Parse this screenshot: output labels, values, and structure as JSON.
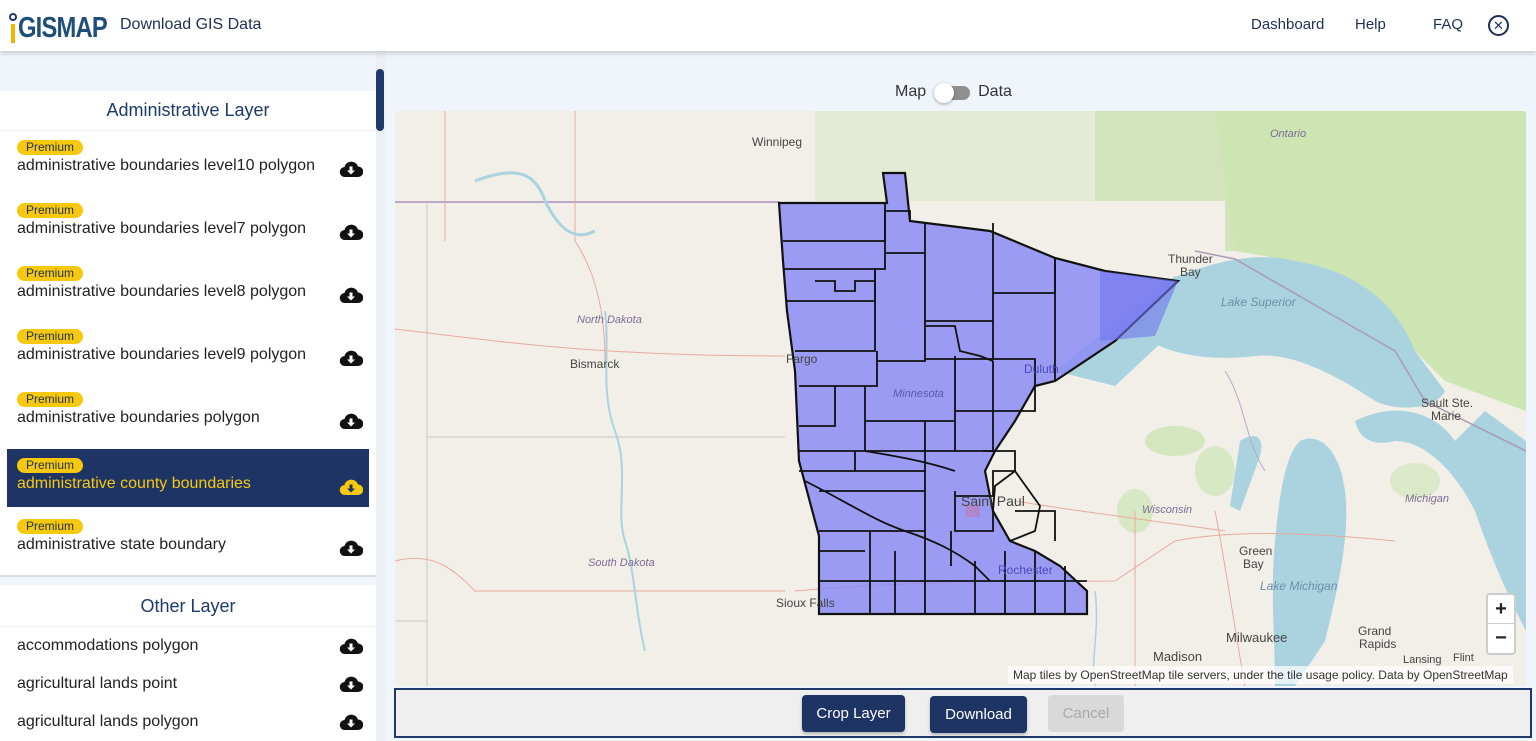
{
  "header": {
    "logo_text": "GISMAP",
    "app_title": "Download GIS Data",
    "nav": [
      "Dashboard",
      "Help",
      "FAQ"
    ],
    "close_icon": "close-circle-icon"
  },
  "sidebar": {
    "admin_section_title": "Administrative Layer",
    "admin_items": [
      {
        "badge": "Premium",
        "label": "administrative boundaries level10 polygon",
        "icon": "cloud-download-icon",
        "selected": false
      },
      {
        "badge": "Premium",
        "label": "administrative boundaries level7 polygon",
        "icon": "cloud-download-icon",
        "selected": false
      },
      {
        "badge": "Premium",
        "label": "administrative boundaries level8 polygon",
        "icon": "cloud-download-icon",
        "selected": false
      },
      {
        "badge": "Premium",
        "label": "administrative boundaries level9 polygon",
        "icon": "cloud-download-icon",
        "selected": false
      },
      {
        "badge": "Premium",
        "label": "administrative boundaries polygon",
        "icon": "cloud-download-icon",
        "selected": false
      },
      {
        "badge": "Premium",
        "label": "administrative county boundaries",
        "icon": "cloud-download-icon",
        "selected": true
      },
      {
        "badge": "Premium",
        "label": "administrative state boundary",
        "icon": "cloud-download-icon",
        "selected": false
      }
    ],
    "other_section_title": "Other Layer",
    "other_items": [
      {
        "label": "accommodations polygon",
        "icon": "cloud-download-icon"
      },
      {
        "label": "agricultural lands point",
        "icon": "cloud-download-icon"
      },
      {
        "label": "agricultural lands polygon",
        "icon": "cloud-download-icon"
      }
    ]
  },
  "view_toggle": {
    "left_label": "Map",
    "right_label": "Data",
    "active": "Map"
  },
  "map": {
    "highlighted_region": "Minnesota counties",
    "fill_color": "#8c8cf5",
    "border_color": "#111111",
    "labels": {
      "winnipeg": "Winnipeg",
      "ontario": "Ontario",
      "thunder_bay_1": "Thunder",
      "thunder_bay_2": "Bay",
      "lake_superior": "Lake Superior",
      "north_dakota": "North Dakota",
      "bismarck": "Bismarck",
      "fargo": "Fargo",
      "duluth": "Duluth",
      "minnesota": "Minnesota",
      "sault_1": "Sault Ste.",
      "sault_2": "Marie",
      "saint_paul": "Saint Paul",
      "wisconsin": "Wisconsin",
      "michigan": "Michigan",
      "green_bay_1": "Green",
      "green_bay_2": "Bay",
      "south_dakota": "South Dakota",
      "rochester": "Rochester",
      "sioux_falls": "Sioux Falls",
      "lake_michigan": "Lake Michigan",
      "milwaukee": "Milwaukee",
      "grand_rapids_1": "Grand",
      "grand_rapids_2": "Rapids",
      "madison": "Madison",
      "lansing": "Lansing",
      "flint": "Flint"
    },
    "zoom_in": "+",
    "zoom_out": "−",
    "attribution": "Map tiles by OpenStreetMap tile servers, under the tile usage policy. Data by OpenStreetMap"
  },
  "actions": {
    "crop": "Crop Layer",
    "download": "Download",
    "cancel": "Cancel",
    "cancel_disabled": true
  }
}
